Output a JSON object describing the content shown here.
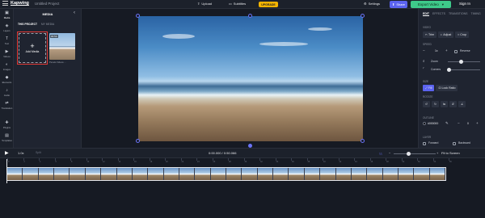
{
  "topbar": {
    "logo": "Kapwing",
    "project_title": "Untitled Project",
    "upload_label": "Upload",
    "subtitles_label": "Subtitles",
    "upgrade_label": "UPGRADE",
    "settings_label": "Settings",
    "share_label": "Share",
    "export_label": "Export Video",
    "signin_label": "Sign In"
  },
  "leftnav": {
    "items": [
      {
        "label": "Media",
        "icon": "media-icon"
      },
      {
        "label": "Layers",
        "icon": "layers-icon"
      },
      {
        "label": "Text",
        "icon": "text-icon"
      },
      {
        "label": "Videos",
        "icon": "videos-icon"
      },
      {
        "label": "Images",
        "icon": "images-icon"
      },
      {
        "label": "Elements",
        "icon": "elements-icon"
      },
      {
        "label": "Audio",
        "icon": "audio-icon"
      },
      {
        "label": "Translation",
        "icon": "translation-icon"
      },
      {
        "label": "Plugins",
        "icon": "plugins-icon"
      },
      {
        "label": "Templates",
        "icon": "templates-icon"
      }
    ]
  },
  "media": {
    "title": "MEDIA",
    "tab_project": "THIS PROJECT",
    "tab_my_media": "MY MEDIA",
    "add_media_label": "Add Media",
    "thumb_duration": "00:50",
    "thumb_name": "Pexels Videos ..."
  },
  "rightpanel": {
    "tabs": [
      "EDIT",
      "EFFECTS",
      "TRANSITIONS",
      "TIMING"
    ],
    "video_section": "VIDEO",
    "trim_label": "Trim",
    "adjust_label": "Adjust",
    "crop_label": "Crop",
    "speed_section": "SPEED",
    "speed_value": "1x",
    "reverse_label": "Reverse",
    "zoom_label": "Zoom",
    "corners_label": "Corners",
    "size_section": "SIZE",
    "fill_label": "Fill",
    "lock_ratio_label": "Lock Ratio",
    "rotate_section": "ROTATE",
    "outline_section": "OUTLINE",
    "outline_color": "#000000",
    "outline_width": "0",
    "layer_section": "LAYER",
    "forward_label": "Forward",
    "backward_label": "Backward"
  },
  "bottombar": {
    "speed": "1.0x",
    "split_label": "Split",
    "timecode": "0:00.000 / 0:50.066",
    "fit_label": "Fit to Screen"
  },
  "ruler": {
    "labels": [
      "0",
      "2",
      "4",
      "6",
      "8",
      "10",
      "12",
      "14",
      "16",
      "18",
      "20",
      "22",
      "24",
      "26",
      "28",
      "30",
      "32",
      "34",
      "36",
      "38",
      "40",
      "42",
      "44",
      "46",
      "48",
      "50",
      "52",
      "54",
      "56"
    ]
  },
  "colors": {
    "accent": "#5b63f0",
    "export": "#3ec98a",
    "upgrade": "#f5b400",
    "highlight": "#e53935"
  }
}
